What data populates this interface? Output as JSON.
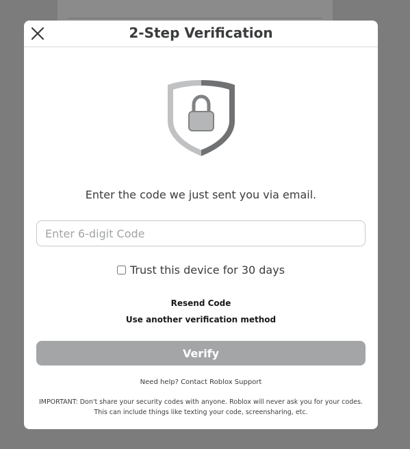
{
  "modal": {
    "title": "2-Step Verification",
    "close_icon": "close-icon",
    "shield_icon": "shield-lock-icon",
    "instructions": "Enter the code we just sent you via email.",
    "code_input": {
      "placeholder": "Enter 6-digit Code",
      "value": ""
    },
    "trust_device": {
      "label": "Trust this device for 30 days",
      "checked": false
    },
    "resend_label": "Resend Code",
    "another_method_label": "Use another verification method",
    "verify_label": "Verify",
    "help_text": "Need help? Contact Roblox Support",
    "important_text": "IMPORTANT: Don't share your security codes with anyone. Roblox will never ask you for your codes. This can include things like texting your code, screensharing, etc."
  },
  "colors": {
    "backdrop": "#7b7c7b",
    "text": "#393b3d",
    "verify_disabled": "#a3a5a7",
    "shield_dark": "#6f7173",
    "shield_light": "#bfc1c3"
  }
}
